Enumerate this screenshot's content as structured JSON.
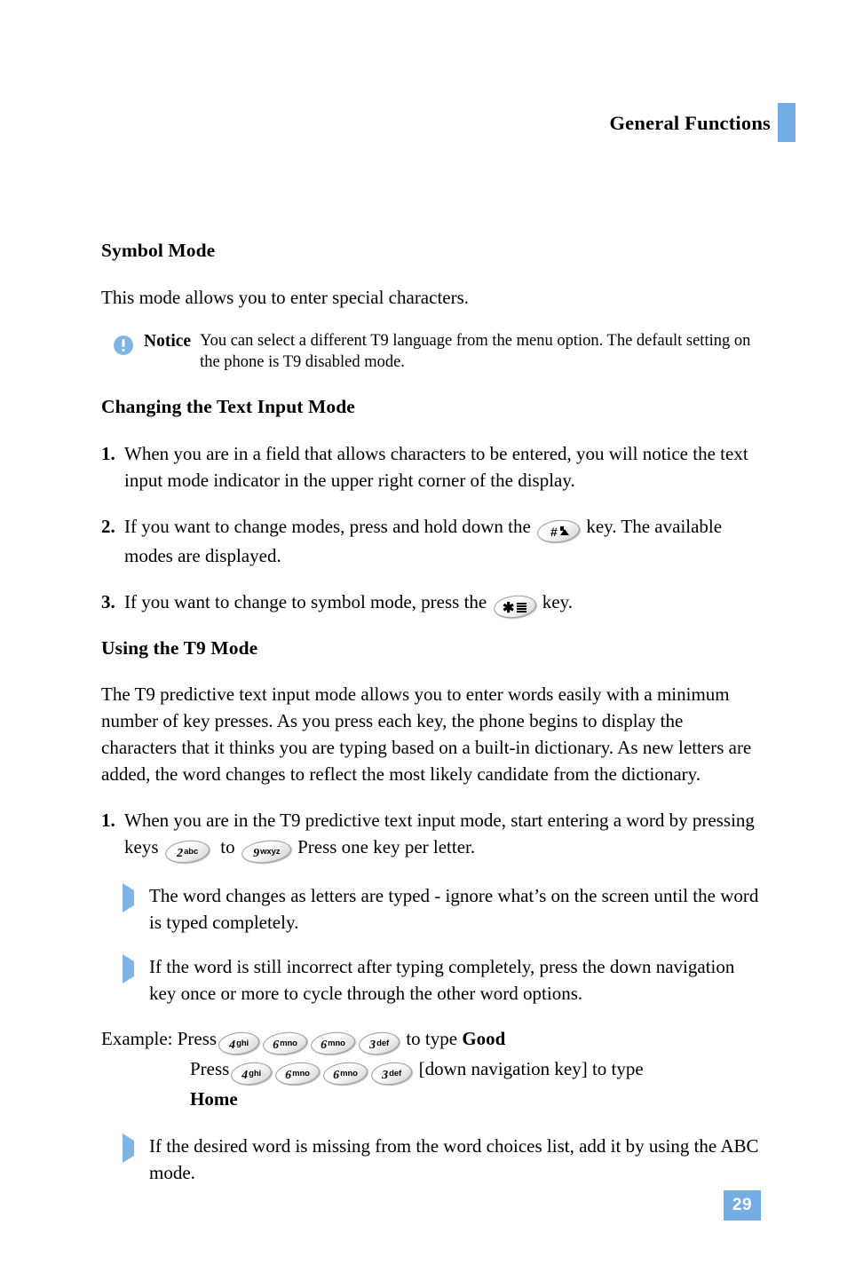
{
  "header": {
    "title": "General Functions",
    "accent_color": "#74ace4"
  },
  "sections": {
    "symbol_mode": {
      "heading": "Symbol Mode",
      "paragraph": "This mode allows you to enter special characters.",
      "notice": {
        "label": "Notice",
        "text": "You can select a different T9 language from the menu option. The default setting on the phone is T9 disabled mode.",
        "icon": "exclamation-circle-icon"
      }
    },
    "changing_text_input_mode": {
      "heading": "Changing the Text Input Mode",
      "steps": [
        {
          "number": "1.",
          "text": "When you are in a field that allows characters to be entered, you will notice the text input mode indicator in the upper right corner of the display."
        },
        {
          "number": "2.",
          "text_before": "If you want to change modes, press and hold down the",
          "key": "hash-shift-key",
          "text_after": "key. The available modes are displayed."
        },
        {
          "number": "3.",
          "text_before": "If you want to change to symbol mode, press the",
          "key": "star-symbol-key",
          "text_after": "key."
        }
      ]
    },
    "using_t9_mode": {
      "heading": "Using the T9 Mode",
      "paragraph": "The T9 predictive text input mode allows you to enter words easily with a minimum number of key presses. As you press each key, the phone begins to display the characters that it thinks you are typing based on a built-in dictionary. As new letters are added, the word changes to reflect the most likely candidate from the dictionary.",
      "step1": {
        "number": "1.",
        "text_before": "When you are in the T9 predictive text input mode, start entering a word by pressing keys",
        "key_from": {
          "digit": "2",
          "letters": "abc"
        },
        "text_middle": "to",
        "key_to": {
          "digit": "9",
          "letters": "wxyz"
        },
        "text_after": "Press one key per letter."
      },
      "bullets": [
        "The word changes as letters are typed - ignore what’s on the screen until the word is typed completely.",
        "If the word is still incorrect after typing completely, press the down navigation key once or more to cycle through the other word options."
      ],
      "example": {
        "label": "Example:",
        "line1_press": "Press",
        "line1_keys": [
          {
            "digit": "4",
            "letters": "ghi"
          },
          {
            "digit": "6",
            "letters": "mno"
          },
          {
            "digit": "6",
            "letters": "mno"
          },
          {
            "digit": "3",
            "letters": "def"
          }
        ],
        "line1_tail": "to type",
        "line1_word": "Good",
        "line2_press": "Press",
        "line2_keys": [
          {
            "digit": "4",
            "letters": "ghi"
          },
          {
            "digit": "6",
            "letters": "mno"
          },
          {
            "digit": "6",
            "letters": "mno"
          },
          {
            "digit": "3",
            "letters": "def"
          }
        ],
        "line2_tail": "[down navigation key] to type",
        "line3_word": "Home"
      },
      "final_bullet": "If the desired word is missing from the word choices list, add it by using the ABC mode."
    }
  },
  "footer": {
    "page_number": "29"
  }
}
